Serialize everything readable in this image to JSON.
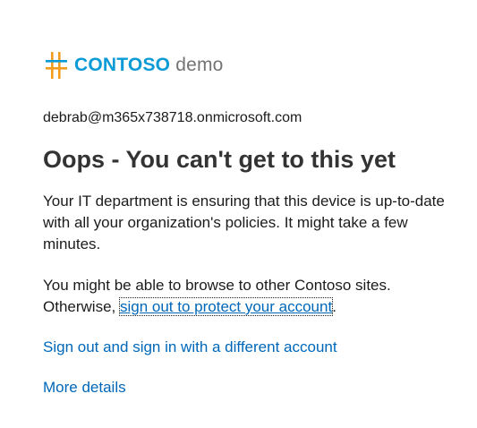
{
  "logo": {
    "icon": "contoso-hashtag-logo-icon",
    "brand_strong": "CONTOSO",
    "brand_light": "demo",
    "colors": {
      "orange": "#f29c1f",
      "blue": "#0a9bd6"
    }
  },
  "account": {
    "email": "debrab@m365x738718.onmicrosoft.com"
  },
  "heading": "Oops - You can't get to this yet",
  "message": {
    "paragraph1": "Your IT department is ensuring that this device is up-to-date with all your organization's policies. It might take a few minutes.",
    "paragraph2_prefix": "You might be able to browse to other Contoso sites. Otherwise, ",
    "paragraph2_link": "sign out to protect your account",
    "paragraph2_suffix": "."
  },
  "links": {
    "switch_account": "Sign out and sign in with a different account",
    "more_details": "More details"
  },
  "colors": {
    "link": "#0067b8",
    "text": "#1b1b1b",
    "heading": "#333333"
  }
}
